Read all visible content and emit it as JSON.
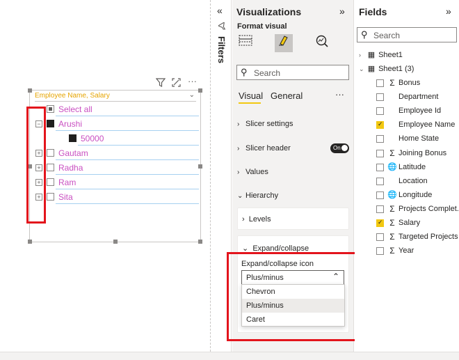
{
  "slicer": {
    "header": "Employee Name, Salary",
    "rows": [
      {
        "label": "Select all",
        "expander": ""
      },
      {
        "label": "Arushi",
        "expander": "−"
      },
      {
        "label": "50000",
        "expander": ""
      },
      {
        "label": "Gautam",
        "expander": "+"
      },
      {
        "label": "Radha",
        "expander": "+"
      },
      {
        "label": "Ram",
        "expander": "+"
      },
      {
        "label": "Sita",
        "expander": "+"
      }
    ]
  },
  "filters": {
    "label": "Filters"
  },
  "viz": {
    "title": "Visualizations",
    "format_visual": "Format visual",
    "search_placeholder": "Search",
    "tabs": {
      "visual": "Visual",
      "general": "General",
      "more": "···"
    },
    "sections": {
      "slicer_settings": "Slicer settings",
      "slicer_header": "Slicer header",
      "values": "Values",
      "hierarchy": "Hierarchy",
      "levels": "Levels",
      "expand_collapse": "Expand/collapse",
      "expand_collapse_icon": "Expand/collapse icon"
    },
    "toggle_text": "On",
    "select_value": "Plus/minus",
    "options": [
      "Chevron",
      "Plus/minus",
      "Caret"
    ]
  },
  "fields": {
    "title": "Fields",
    "search_placeholder": "Search",
    "tables": [
      {
        "name": "Sheet1"
      },
      {
        "name": "Sheet1 (3)"
      }
    ],
    "items": [
      {
        "name": "Bonus",
        "icon": "Σ",
        "checked": false
      },
      {
        "name": "Department",
        "icon": "",
        "checked": false
      },
      {
        "name": "Employee Id",
        "icon": "",
        "checked": false
      },
      {
        "name": "Employee Name",
        "icon": "",
        "checked": true
      },
      {
        "name": "Home State",
        "icon": "",
        "checked": false
      },
      {
        "name": "Joining Bonus",
        "icon": "Σ",
        "checked": false
      },
      {
        "name": "Latitude",
        "icon": "globe",
        "checked": false
      },
      {
        "name": "Location",
        "icon": "",
        "checked": false
      },
      {
        "name": "Longitude",
        "icon": "globe",
        "checked": false
      },
      {
        "name": "Projects Complet...",
        "icon": "Σ",
        "checked": false
      },
      {
        "name": "Salary",
        "icon": "Σ",
        "checked": true
      },
      {
        "name": "Targeted Projects",
        "icon": "Σ",
        "checked": false
      },
      {
        "name": "Year",
        "icon": "Σ",
        "checked": false
      }
    ]
  },
  "colors": {
    "accent": "#f2c811",
    "highlight": "#e3141c",
    "slicer_text": "#c94fc1",
    "header_text": "#e6a400"
  }
}
